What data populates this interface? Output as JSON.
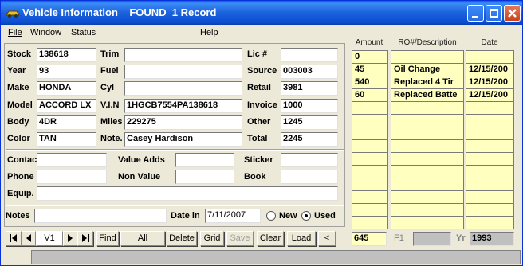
{
  "window": {
    "title": "Vehicle Information    FOUND  1 Record"
  },
  "menu": {
    "file": "File",
    "window": "Window",
    "status": "Status",
    "help": "Help"
  },
  "vehicle": {
    "stock_label": "Stock",
    "stock": "138618",
    "year_label": "Year",
    "year": "93",
    "make_label": "Make",
    "make": "HONDA",
    "model_label": "Model",
    "model": "ACCORD LX",
    "body_label": "Body",
    "body": "4DR",
    "color_label": "Color",
    "color": "TAN",
    "trim_label": "Trim",
    "trim": "",
    "fuel_label": "Fuel",
    "fuel": "",
    "cyl_label": "Cyl",
    "cyl": "",
    "vin_label": "V.I.N",
    "vin": "1HGCB7554PA138618",
    "miles_label": "Miles",
    "miles": "229275",
    "note_label": "Note.",
    "note": "Casey Hardison",
    "lic_label": "Lic #",
    "lic": "",
    "source_label": "Source",
    "source": "003003",
    "retail_label": "Retail",
    "retail": "3981",
    "invoice_label": "Invoice",
    "invoice": "1000",
    "other_label": "Other",
    "other": "1245",
    "total_label": "Total",
    "total": "2245"
  },
  "extra": {
    "contact_label": "Contac",
    "contact": "",
    "phone_label": "Phone",
    "phone": "",
    "equip_label": "Equip.",
    "equip": "",
    "value_adds_label": "Value Adds",
    "value_adds": "",
    "non_value_label": "Non Value",
    "non_value": "",
    "sticker_label": "Sticker",
    "sticker": "",
    "book_label": "Book",
    "book": "",
    "notes_label": "Notes",
    "notes": "",
    "date_in_label": "Date in",
    "date_in": "7/11/2007",
    "new_label": "New",
    "used_label": "Used"
  },
  "grid": {
    "headers": [
      "Amount",
      "RO#/Description",
      "Date"
    ],
    "rows": [
      [
        "0",
        "",
        ""
      ],
      [
        "45",
        "Oil Change",
        "12/15/200"
      ],
      [
        "540",
        "Replaced 4 Tir",
        "12/15/200"
      ],
      [
        "60",
        "Replaced Batte",
        "12/15/200"
      ]
    ],
    "total": "645",
    "f1_label": "F1",
    "f1": "",
    "yr_label": "Yr",
    "yr": "1993"
  },
  "nav": {
    "record": "V1",
    "find": "Find",
    "all": "All",
    "delete": "Delete",
    "grid": "Grid",
    "save": "Save",
    "clear": "Clear",
    "load": "Load",
    "back": "<"
  }
}
